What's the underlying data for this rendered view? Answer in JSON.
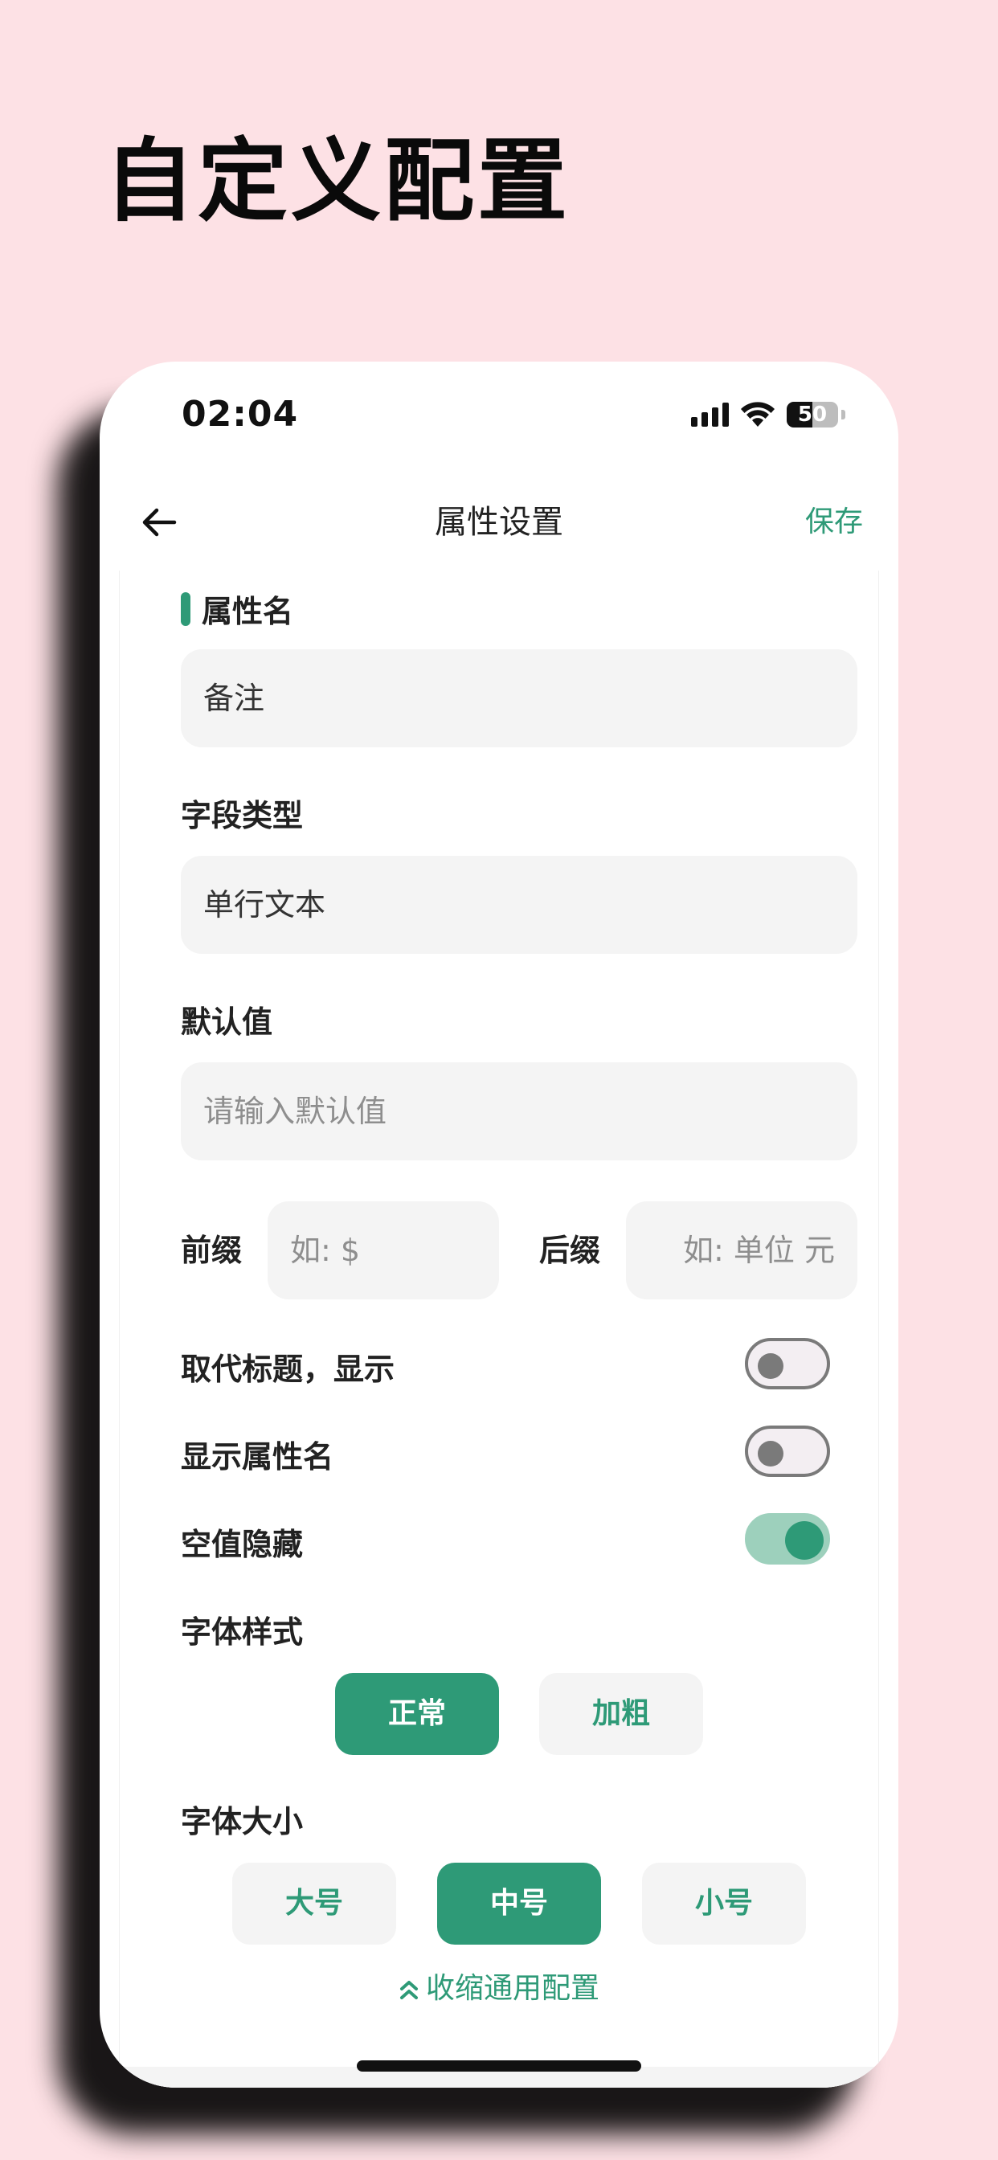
{
  "headline": "自定义配置",
  "status_bar": {
    "time": "02:04",
    "battery": "50",
    "battery_level": 0.5
  },
  "nav": {
    "title": "属性设置",
    "save_label": "保存",
    "back_icon": "arrow-left-icon"
  },
  "form": {
    "name_label": "属性名",
    "name_value": "备注",
    "type_label": "字段类型",
    "type_value": "单行文本",
    "default_label": "默认值",
    "default_placeholder": "请输入默认值",
    "prefix_label": "前缀",
    "prefix_placeholder": "如: $",
    "suffix_label": "后缀",
    "suffix_placeholder": "如: 单位 元",
    "toggles": [
      {
        "label": "取代标题，显示",
        "on": false
      },
      {
        "label": "显示属性名",
        "on": false
      },
      {
        "label": "空值隐藏",
        "on": true
      }
    ],
    "font_style_label": "字体样式",
    "font_style_options": [
      "正常",
      "加粗"
    ],
    "font_style_selected": "正常",
    "font_size_label": "字体大小",
    "font_size_options": [
      "大号",
      "中号",
      "小号"
    ],
    "font_size_selected": "中号",
    "collapse_label": "收缩通用配置"
  },
  "colors": {
    "accent": "#2e9a77",
    "background": "#fde1e5",
    "toggle_on_track": "#9dd0bc"
  }
}
